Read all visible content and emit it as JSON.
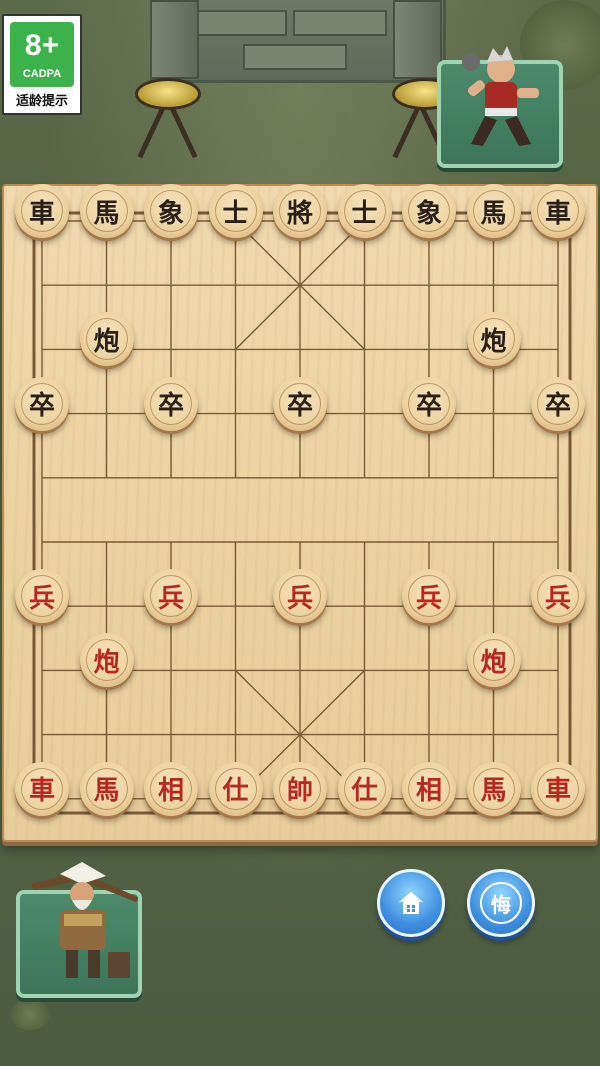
{
  "age_rating": {
    "age": "8+",
    "org": "CADPA",
    "hint": "适龄提示"
  },
  "opponent": {
    "name": "opponent-avatar"
  },
  "player": {
    "name": "player-avatar"
  },
  "board": {
    "cols": 9,
    "rows": 10,
    "pieces": [
      {
        "label": "車",
        "side": "black",
        "col": 0,
        "row": 0
      },
      {
        "label": "馬",
        "side": "black",
        "col": 1,
        "row": 0
      },
      {
        "label": "象",
        "side": "black",
        "col": 2,
        "row": 0
      },
      {
        "label": "士",
        "side": "black",
        "col": 3,
        "row": 0
      },
      {
        "label": "將",
        "side": "black",
        "col": 4,
        "row": 0
      },
      {
        "label": "士",
        "side": "black",
        "col": 5,
        "row": 0
      },
      {
        "label": "象",
        "side": "black",
        "col": 6,
        "row": 0
      },
      {
        "label": "馬",
        "side": "black",
        "col": 7,
        "row": 0
      },
      {
        "label": "車",
        "side": "black",
        "col": 8,
        "row": 0
      },
      {
        "label": "炮",
        "side": "black",
        "col": 1,
        "row": 2
      },
      {
        "label": "炮",
        "side": "black",
        "col": 7,
        "row": 2
      },
      {
        "label": "卒",
        "side": "black",
        "col": 0,
        "row": 3
      },
      {
        "label": "卒",
        "side": "black",
        "col": 2,
        "row": 3
      },
      {
        "label": "卒",
        "side": "black",
        "col": 4,
        "row": 3
      },
      {
        "label": "卒",
        "side": "black",
        "col": 6,
        "row": 3
      },
      {
        "label": "卒",
        "side": "black",
        "col": 8,
        "row": 3
      },
      {
        "label": "兵",
        "side": "red",
        "col": 0,
        "row": 6
      },
      {
        "label": "兵",
        "side": "red",
        "col": 2,
        "row": 6
      },
      {
        "label": "兵",
        "side": "red",
        "col": 4,
        "row": 6
      },
      {
        "label": "兵",
        "side": "red",
        "col": 6,
        "row": 6
      },
      {
        "label": "兵",
        "side": "red",
        "col": 8,
        "row": 6
      },
      {
        "label": "炮",
        "side": "red",
        "col": 1,
        "row": 7
      },
      {
        "label": "炮",
        "side": "red",
        "col": 7,
        "row": 7
      },
      {
        "label": "車",
        "side": "red",
        "col": 0,
        "row": 9
      },
      {
        "label": "馬",
        "side": "red",
        "col": 1,
        "row": 9
      },
      {
        "label": "相",
        "side": "red",
        "col": 2,
        "row": 9
      },
      {
        "label": "仕",
        "side": "red",
        "col": 3,
        "row": 9
      },
      {
        "label": "帥",
        "side": "red",
        "col": 4,
        "row": 9
      },
      {
        "label": "仕",
        "side": "red",
        "col": 5,
        "row": 9
      },
      {
        "label": "相",
        "side": "red",
        "col": 6,
        "row": 9
      },
      {
        "label": "馬",
        "side": "red",
        "col": 7,
        "row": 9
      },
      {
        "label": "車",
        "side": "red",
        "col": 8,
        "row": 9
      }
    ]
  },
  "controls": {
    "home_icon": "home-icon",
    "undo_label": "悔"
  },
  "colors": {
    "red_piece_text": "#b8281f",
    "black_piece_text": "#2a2018",
    "button_blue": "#3f8fe0"
  }
}
